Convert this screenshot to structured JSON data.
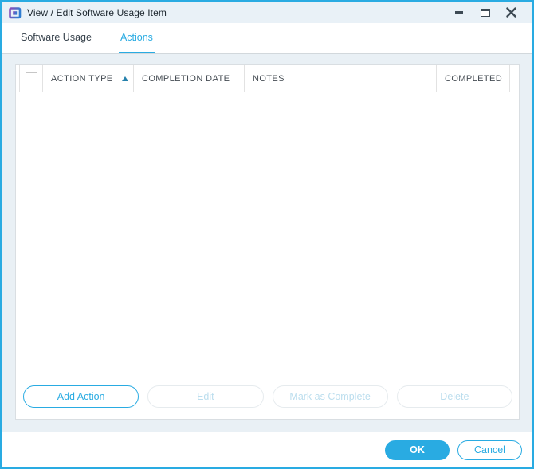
{
  "window": {
    "title": "View / Edit Software Usage Item"
  },
  "tabs": [
    {
      "label": "Software Usage",
      "active": false
    },
    {
      "label": "Actions",
      "active": true
    }
  ],
  "table": {
    "select_all_checkbox": {
      "checked": false
    },
    "columns": [
      {
        "label": "ACTION TYPE",
        "sorted": "ascending"
      },
      {
        "label": "COMPLETION DATE",
        "sorted": null
      },
      {
        "label": "NOTES",
        "sorted": null
      },
      {
        "label": "COMPLETED",
        "sorted": null
      }
    ],
    "rows": []
  },
  "action_buttons": [
    {
      "label": "Add Action",
      "enabled": true
    },
    {
      "label": "Edit",
      "enabled": false
    },
    {
      "label": "Mark as Complete",
      "enabled": false
    },
    {
      "label": "Delete",
      "enabled": false
    }
  ],
  "footer": {
    "ok_label": "OK",
    "cancel_label": "Cancel"
  },
  "colors": {
    "accent": "#29abe2",
    "window_background": "#e9f0f5",
    "titlebar_background": "#e9f1f7",
    "sort_arrow": "#2581ac",
    "disabled_text": "#bcdeee",
    "header_text": "#454c53"
  }
}
